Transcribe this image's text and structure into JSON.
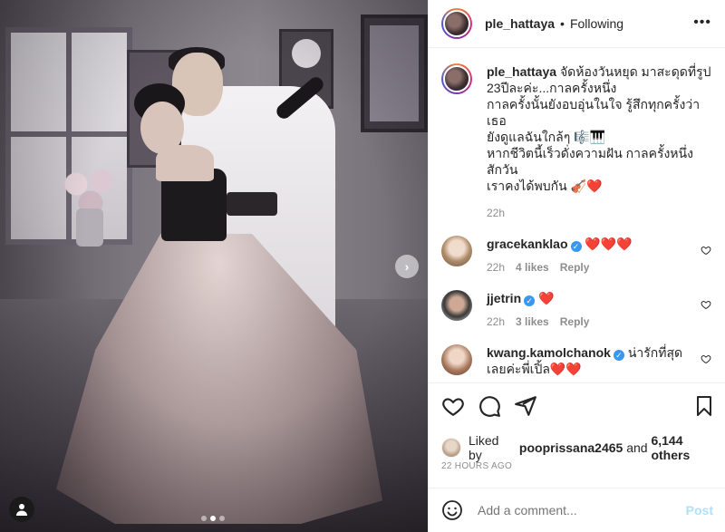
{
  "post": {
    "username": "ple_hattaya",
    "follow_status": "Following",
    "caption_lines": [
      "จัดห้องวันหยุด มาสะดุดที่รูป",
      "23ปีละค่ะ...กาลครั้งหนึ่ง",
      "กาลครั้งนั้นยังอบอุ่นในใจ รู้สึกทุกครั้งว่าเธอ",
      "ยังดูแลฉันใกล้ๆ 🎼🎹",
      "หากชีวิตนี้เร็วดั่งความฝัน กาลครั้งหนึ่ง สักวัน",
      "เราคงได้พบกัน 🎻❤️"
    ],
    "caption_time": "22h"
  },
  "comments": [
    {
      "username": "gracekanklao",
      "verified": true,
      "text": "❤️❤️❤️",
      "time": "22h",
      "likes": "4 likes",
      "reply": "Reply"
    },
    {
      "username": "jjetrin",
      "verified": true,
      "text": "❤️",
      "time": "22h",
      "likes": "3 likes",
      "reply": "Reply"
    },
    {
      "username": "kwang.kamolchanok",
      "verified": true,
      "text": "น่ารักที่สุด",
      "text2": "เลยค่ะพี่เปิ้ล❤️❤️"
    }
  ],
  "likes": {
    "prefix": "Liked by ",
    "user": "pooprissana2465",
    "middle": " and ",
    "count": "6,144 others"
  },
  "posted_ago": "22 HOURS AGO",
  "add_comment": {
    "placeholder": "Add a comment...",
    "post_label": "Post"
  },
  "carousel": {
    "total": 3,
    "active": 1
  },
  "colors": {
    "verified": "#3897f0",
    "heart": "#ed4956",
    "post_disabled": "#b2dffc",
    "muted": "#8e8e8e"
  },
  "icons": [
    "more-icon",
    "heart-icon",
    "comment-icon",
    "share-icon",
    "bookmark-icon",
    "emoji-icon",
    "chevron-right-icon",
    "user-tag-icon"
  ]
}
